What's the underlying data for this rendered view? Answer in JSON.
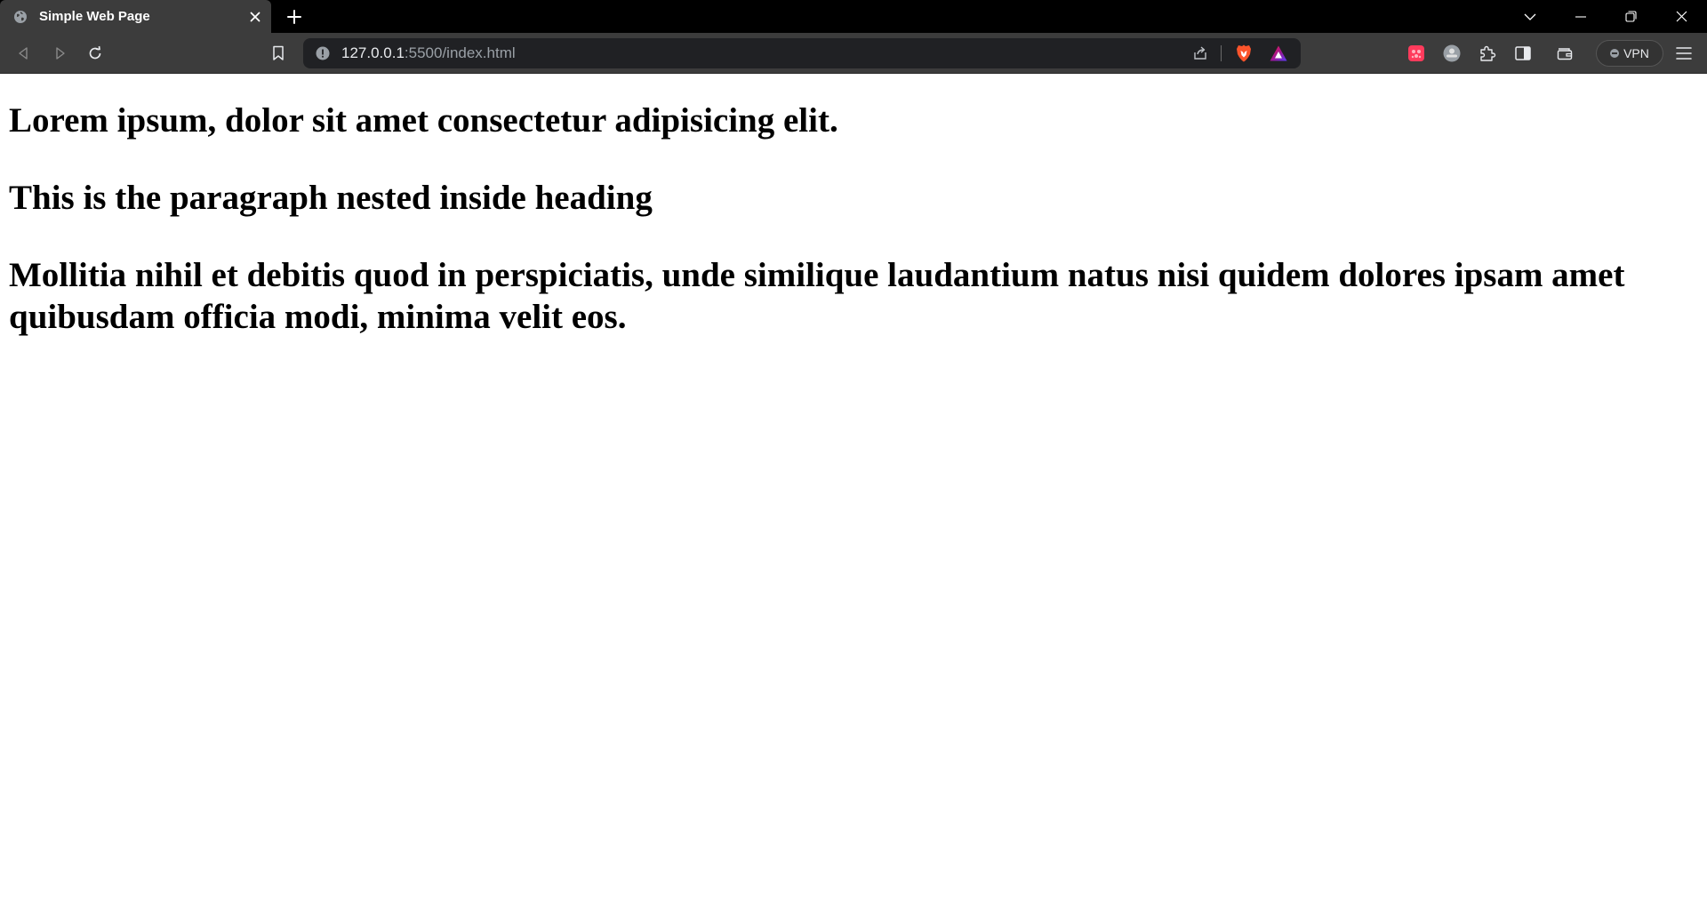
{
  "tab": {
    "title": "Simple Web Page",
    "favicon": "globe-icon"
  },
  "window_controls": [
    "chevron-down-icon",
    "minimize-icon",
    "restore-icon",
    "close-icon"
  ],
  "toolbar": {
    "back_icon": "back-icon",
    "forward_icon": "forward-icon",
    "reload_icon": "reload-icon",
    "bookmark_icon": "bookmark-icon",
    "url_host": "127.0.0.1",
    "url_rest": ":5500/index.html",
    "share_icon": "share-icon",
    "brave_shields_icon": "brave-shields-icon",
    "brave_rewards_icon": "brave-rewards-icon",
    "extensions": [
      "extension-red-icon",
      "extension-grey-icon",
      "puzzle-icon"
    ],
    "sidebar_icon": "sidebar-icon",
    "wallet_icon": "wallet-icon",
    "vpn_label": "VPN",
    "menu_icon": "hamburger-menu-icon"
  },
  "colors": {
    "tabstrip": "#000000",
    "toolbar": "#3c3c3c",
    "omnibox": "#202124",
    "brave_orange": "#fb542b",
    "page_background": "#ffffff"
  },
  "page": {
    "heading_1": "Lorem ipsum, dolor sit amet consectetur adipisicing elit.",
    "heading_2": "This is the paragraph nested inside heading",
    "heading_3": "Mollitia nihil et debitis quod in perspiciatis, unde similique laudantium natus nisi quidem dolores ipsam amet quibusdam officia modi, minima velit eos."
  }
}
